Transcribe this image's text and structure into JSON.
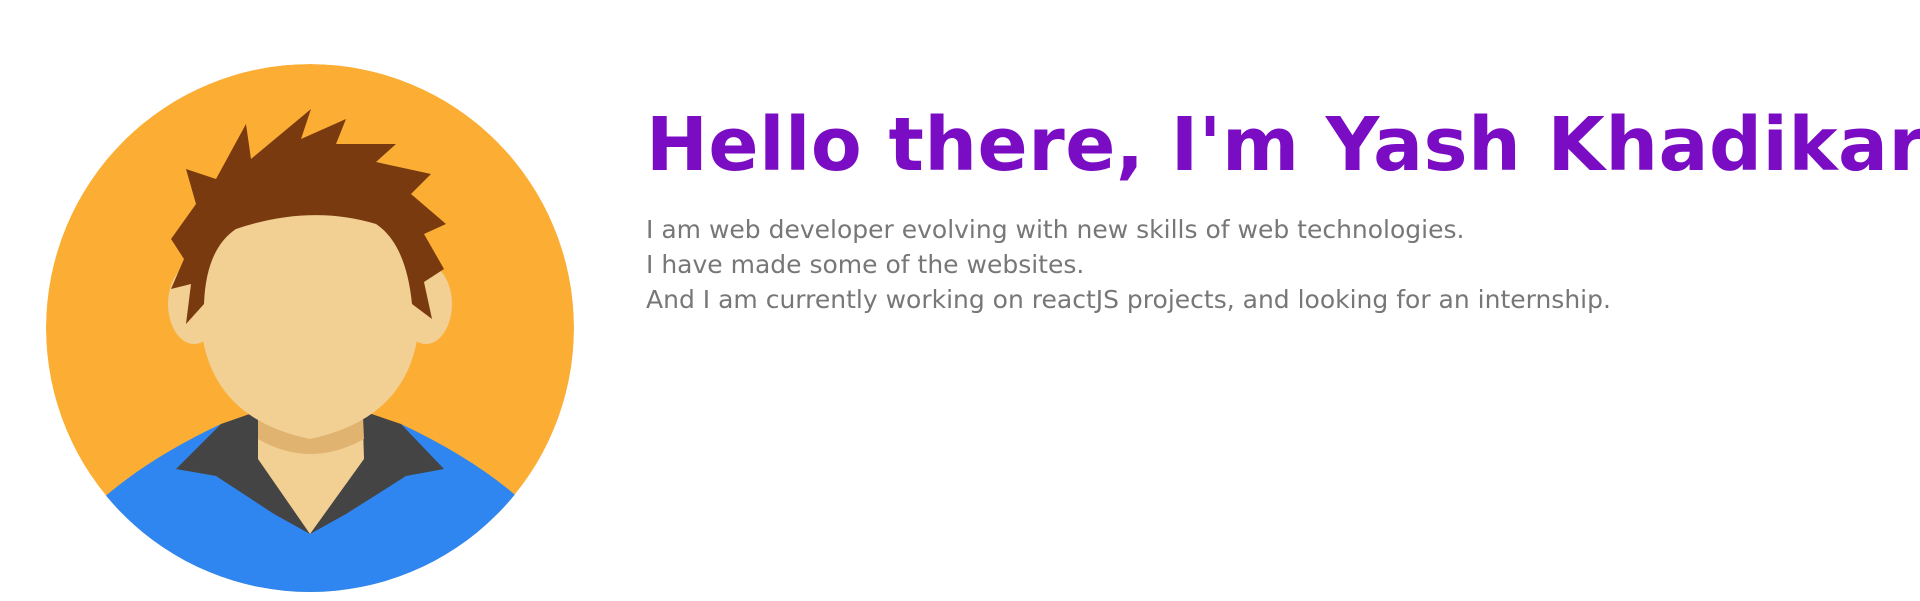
{
  "profile": {
    "avatar_icon": "user-avatar-icon",
    "headline": "Hello there, I'm Yash Khadikar!",
    "bio_lines": [
      "I am web developer evolving with new skills of web technologies.",
      "I have made some of the websites.",
      "And I am currently working on reactJS projects, and looking for an internship."
    ]
  },
  "colors": {
    "headline": "#7a0cc4",
    "bio_text": "#777777",
    "avatar_background": "#fbae33",
    "hair": "#7a3a10",
    "skin": "#f2cf93",
    "collar": "#444444",
    "shirt": "#2f86f0"
  }
}
